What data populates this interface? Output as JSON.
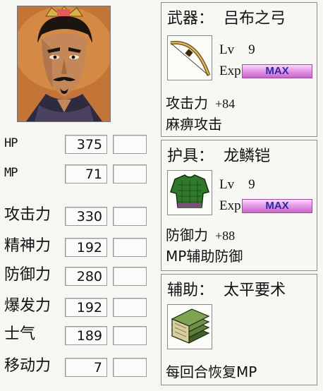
{
  "stats": [
    {
      "label": "HP",
      "value": "375"
    },
    {
      "label": "MP",
      "value": "71"
    },
    {
      "label": "攻击力",
      "value": "330"
    },
    {
      "label": "精神力",
      "value": "192"
    },
    {
      "label": "防御力",
      "value": "280"
    },
    {
      "label": "爆发力",
      "value": "192"
    },
    {
      "label": "士气",
      "value": "189"
    },
    {
      "label": "移动力",
      "value": "7"
    }
  ],
  "weapon": {
    "slot": "武器：",
    "name": "吕布之弓",
    "lv_label": "Lv",
    "lv_value": "9",
    "exp_label": "Exp",
    "exp_bar": "MAX",
    "stat_label": "攻击力",
    "stat_value": "+84",
    "effect": "麻痹攻击"
  },
  "armor": {
    "slot": "护具：",
    "name": "龙鳞铠",
    "lv_label": "Lv",
    "lv_value": "9",
    "exp_label": "Exp",
    "exp_bar": "MAX",
    "stat_label": "防御力",
    "stat_value": "+88",
    "effect": "MP辅助防御"
  },
  "accessory": {
    "slot": "辅助：",
    "name": "太平要术",
    "effect": "每回合恢复MP"
  },
  "colors": {
    "exp_bar": "#d98ad9",
    "exp_text": "#2a2aa8"
  }
}
